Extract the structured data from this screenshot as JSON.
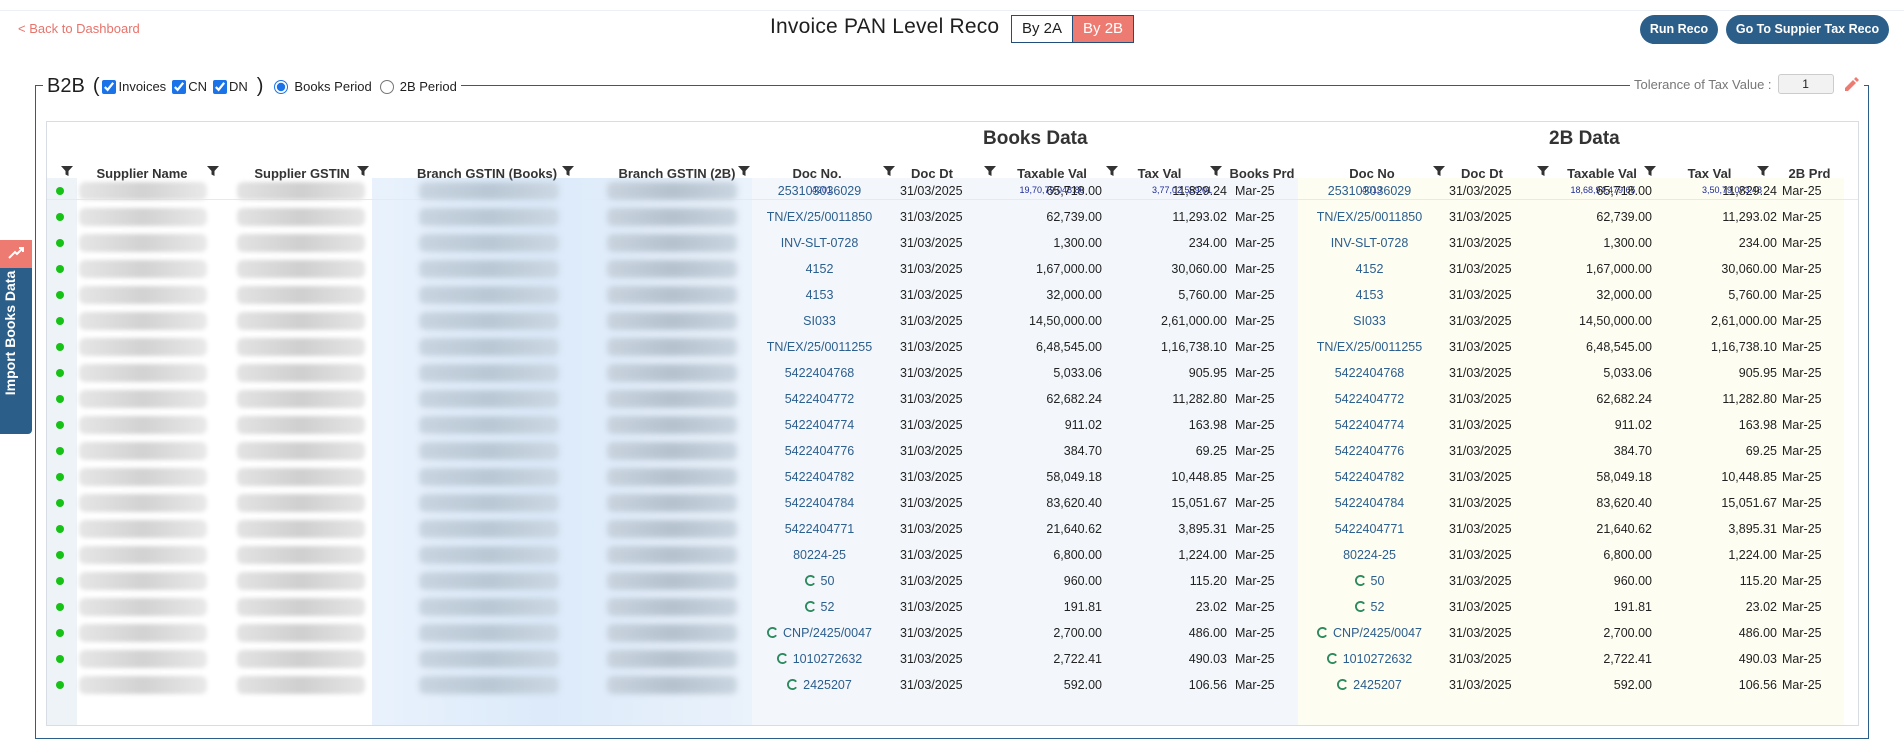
{
  "nav": {
    "back_label": "< Back to Dashboard"
  },
  "page": {
    "title": "Invoice PAN Level Reco"
  },
  "toggle": {
    "by2a": "By 2A",
    "by2b": "By 2B",
    "active": "By 2B"
  },
  "actions": {
    "run_reco": "Run Reco",
    "goto_tax_reco": "Go To Suppier Tax Reco"
  },
  "side_tab": {
    "label": "Import Books Data"
  },
  "filters": {
    "section": "B2B",
    "open_paren": "(",
    "close_paren": ")",
    "invoices": "Invoices",
    "cn": "CN",
    "dn": "DN",
    "books_period": "Books Period",
    "twob_period": "2B Period",
    "selected_period": "Books Period"
  },
  "tolerance": {
    "label": "Tolerance of Tax Value :",
    "value": "1"
  },
  "table": {
    "books_group": "Books Data",
    "twob_group": "2B Data",
    "headers": {
      "supplier_name": "Supplier Name",
      "supplier_gstin": "Supplier GSTIN",
      "branch_books": "Branch GSTIN (Books)",
      "branch_2b": "Branch GSTIN (2B)",
      "books_doc_no": "Doc No.",
      "books_doc_dt": "Doc Dt",
      "books_taxable": "Taxable Val",
      "books_tax": "Tax Val",
      "books_prd": "Books Prd",
      "twob_doc_no": "Doc No",
      "twob_doc_dt": "Doc Dt",
      "twob_taxable": "Taxable Val",
      "twob_tax": "Tax Val",
      "twob_prd": "2B Prd"
    },
    "summary": {
      "books_doc_count": "4201",
      "books_taxable_total": "19,70,79,048.80",
      "books_tax_total": "3,77,02,559.01",
      "twob_doc_count": "4019",
      "twob_taxable_total": "18,68,94,479.65",
      "twob_tax_total": "3,50,79,073.48"
    },
    "status_color": "#15c215",
    "rows": [
      {
        "doc": "253103036029",
        "dt": "31/03/2025",
        "taxable": "65,718.00",
        "tax": "11,829.24",
        "prd": "Mar-25",
        "prd2b": "Mar-25",
        "spinner": false
      },
      {
        "doc": "TN/EX/25/0011850",
        "dt": "31/03/2025",
        "taxable": "62,739.00",
        "tax": "11,293.02",
        "prd": "Mar-25",
        "prd2b": "Mar-25",
        "spinner": false
      },
      {
        "doc": "INV-SLT-0728",
        "dt": "31/03/2025",
        "taxable": "1,300.00",
        "tax": "234.00",
        "prd": "Mar-25",
        "prd2b": "Mar-25",
        "spinner": false
      },
      {
        "doc": "4152",
        "dt": "31/03/2025",
        "taxable": "1,67,000.00",
        "tax": "30,060.00",
        "prd": "Mar-25",
        "prd2b": "Mar-25",
        "spinner": false
      },
      {
        "doc": "4153",
        "dt": "31/03/2025",
        "taxable": "32,000.00",
        "tax": "5,760.00",
        "prd": "Mar-25",
        "prd2b": "Mar-25",
        "spinner": false
      },
      {
        "doc": "SI033",
        "dt": "31/03/2025",
        "taxable": "14,50,000.00",
        "tax": "2,61,000.00",
        "prd": "Mar-25",
        "prd2b": "Mar-25",
        "spinner": false
      },
      {
        "doc": "TN/EX/25/0011255",
        "dt": "31/03/2025",
        "taxable": "6,48,545.00",
        "tax": "1,16,738.10",
        "prd": "Mar-25",
        "prd2b": "Mar-25",
        "spinner": false
      },
      {
        "doc": "5422404768",
        "dt": "31/03/2025",
        "taxable": "5,033.06",
        "tax": "905.95",
        "prd": "Mar-25",
        "prd2b": "Mar-25",
        "spinner": false
      },
      {
        "doc": "5422404772",
        "dt": "31/03/2025",
        "taxable": "62,682.24",
        "tax": "11,282.80",
        "prd": "Mar-25",
        "prd2b": "Mar-25",
        "spinner": false
      },
      {
        "doc": "5422404774",
        "dt": "31/03/2025",
        "taxable": "911.02",
        "tax": "163.98",
        "prd": "Mar-25",
        "prd2b": "Mar-25",
        "spinner": false
      },
      {
        "doc": "5422404776",
        "dt": "31/03/2025",
        "taxable": "384.70",
        "tax": "69.25",
        "prd": "Mar-25",
        "prd2b": "Mar-25",
        "spinner": false
      },
      {
        "doc": "5422404782",
        "dt": "31/03/2025",
        "taxable": "58,049.18",
        "tax": "10,448.85",
        "prd": "Mar-25",
        "prd2b": "Mar-25",
        "spinner": false
      },
      {
        "doc": "5422404784",
        "dt": "31/03/2025",
        "taxable": "83,620.40",
        "tax": "15,051.67",
        "prd": "Mar-25",
        "prd2b": "Mar-25",
        "spinner": false
      },
      {
        "doc": "5422404771",
        "dt": "31/03/2025",
        "taxable": "21,640.62",
        "tax": "3,895.31",
        "prd": "Mar-25",
        "prd2b": "Mar-25",
        "spinner": false
      },
      {
        "doc": "80224-25",
        "dt": "31/03/2025",
        "taxable": "6,800.00",
        "tax": "1,224.00",
        "prd": "Mar-25",
        "prd2b": "Mar-25",
        "spinner": false
      },
      {
        "doc": "50",
        "dt": "31/03/2025",
        "taxable": "960.00",
        "tax": "115.20",
        "prd": "Mar-25",
        "prd2b": "Mar-25",
        "spinner": true
      },
      {
        "doc": "52",
        "dt": "31/03/2025",
        "taxable": "191.81",
        "tax": "23.02",
        "prd": "Mar-25",
        "prd2b": "Mar-25",
        "spinner": true
      },
      {
        "doc": "CNP/2425/0047",
        "dt": "31/03/2025",
        "taxable": "2,700.00",
        "tax": "486.00",
        "prd": "Mar-25",
        "prd2b": "Mar-25",
        "spinner": true
      },
      {
        "doc": "1010272632",
        "dt": "31/03/2025",
        "taxable": "2,722.41",
        "tax": "490.03",
        "prd": "Mar-25",
        "prd2b": "Mar-25",
        "spinner": true
      },
      {
        "doc": "2425207",
        "dt": "31/03/2025",
        "taxable": "592.00",
        "tax": "106.56",
        "prd": "Mar-25",
        "prd2b": "Mar-25",
        "spinner": true
      }
    ]
  },
  "colors": {
    "accent_blue": "#2b5f8a",
    "accent_salmon": "#ee7b72",
    "link": "#2c5e8e",
    "summary_text": "#1d2a9a",
    "status_dot": "#15c215"
  },
  "icons": {
    "filter": "filter-icon",
    "edit": "pencil-icon",
    "status": "status-dot",
    "loading": "spinner-icon",
    "import": "upload-icon"
  }
}
